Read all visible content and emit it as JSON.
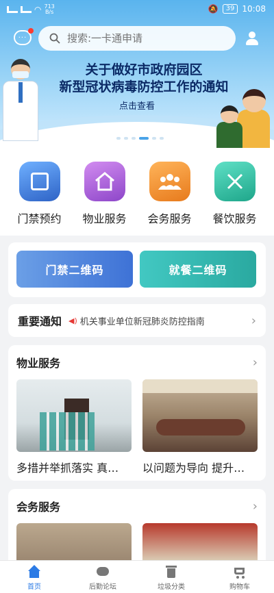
{
  "status_bar": {
    "net_speed_value": "713",
    "net_speed_unit": "B/s",
    "battery": "39",
    "time": "10:08"
  },
  "header": {
    "search_placeholder": "搜索:一卡通申请"
  },
  "banner": {
    "title_line1": "关于做好市政府园区",
    "title_line2": "新型冠状病毒防控工作的通知",
    "link": "点击查看"
  },
  "quick_services": [
    {
      "label": "门禁预约",
      "icon": "door-access-icon",
      "color": "#3e72d6"
    },
    {
      "label": "物业服务",
      "icon": "property-house-icon",
      "color": "#a159d9"
    },
    {
      "label": "会务服务",
      "icon": "meeting-people-icon",
      "color": "#f08a2c"
    },
    {
      "label": "餐饮服务",
      "icon": "dining-utensils-icon",
      "color": "#25b69a"
    }
  ],
  "qr_buttons": [
    {
      "label": "门禁二维码"
    },
    {
      "label": "就餐二维码"
    }
  ],
  "notice": {
    "title": "重要通知",
    "text": "机关事业单位新冠肺炎防控指南"
  },
  "property_section": {
    "title": "物业服务",
    "cards": [
      {
        "title": "多措并举抓落实 真…"
      },
      {
        "title": "以问题为导向 提升…"
      }
    ]
  },
  "meeting_section": {
    "title": "会务服务"
  },
  "tabbar": {
    "tabs": [
      {
        "label": "首页",
        "active": true
      },
      {
        "label": "后勤论坛",
        "active": false
      },
      {
        "label": "垃圾分类",
        "active": false
      },
      {
        "label": "购物车",
        "active": false
      }
    ]
  },
  "colors": {
    "accent": "#2c7be5",
    "notice_icon": "#e53935"
  }
}
